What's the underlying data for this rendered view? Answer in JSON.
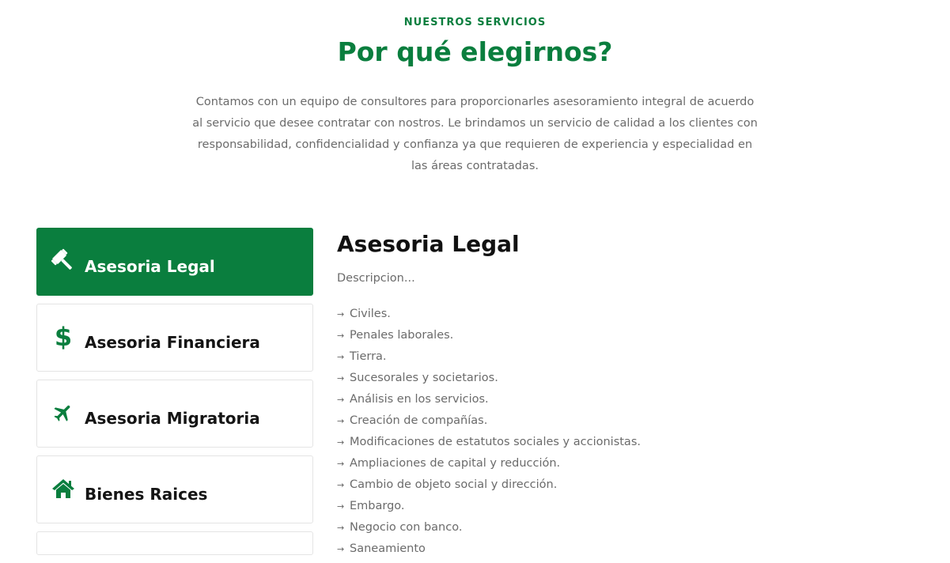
{
  "header": {
    "eyebrow": "NUESTROS SERVICIOS",
    "title": "Por qué elegirnos?",
    "intro": "Contamos con un equipo de consultores para proporcionarles asesoramiento integral de acuerdo al servicio que desee contratar con nostros. Le brindamos un servicio de calidad a los clientes con responsabilidad, confidencialidad y confianza ya que requieren de experiencia y especialidad en las áreas contratadas."
  },
  "tabs": [
    {
      "label": "Asesoria Legal",
      "icon": "gavel-icon",
      "active": true
    },
    {
      "label": "Asesoria Financiera",
      "icon": "dollar-icon",
      "active": false
    },
    {
      "label": "Asesoria Migratoria",
      "icon": "plane-icon",
      "active": false
    },
    {
      "label": "Bienes Raices",
      "icon": "home-icon",
      "active": false
    }
  ],
  "detail": {
    "title": "Asesoria Legal",
    "description": "Descripcion...",
    "items": [
      "Civiles.",
      "Penales laborales.",
      "Tierra.",
      "Sucesorales y societarios.",
      "Análisis en los servicios.",
      "Creación de compañías.",
      "Modificaciones de estatutos sociales y accionistas.",
      "Ampliaciones de capital y reducción.",
      "Cambio de objeto social y dirección.",
      "Embargo.",
      "Negocio con banco.",
      "Saneamiento"
    ]
  },
  "colors": {
    "accent": "#0a7e3e",
    "text_muted": "#6b6b6b",
    "heading": "#111111"
  }
}
